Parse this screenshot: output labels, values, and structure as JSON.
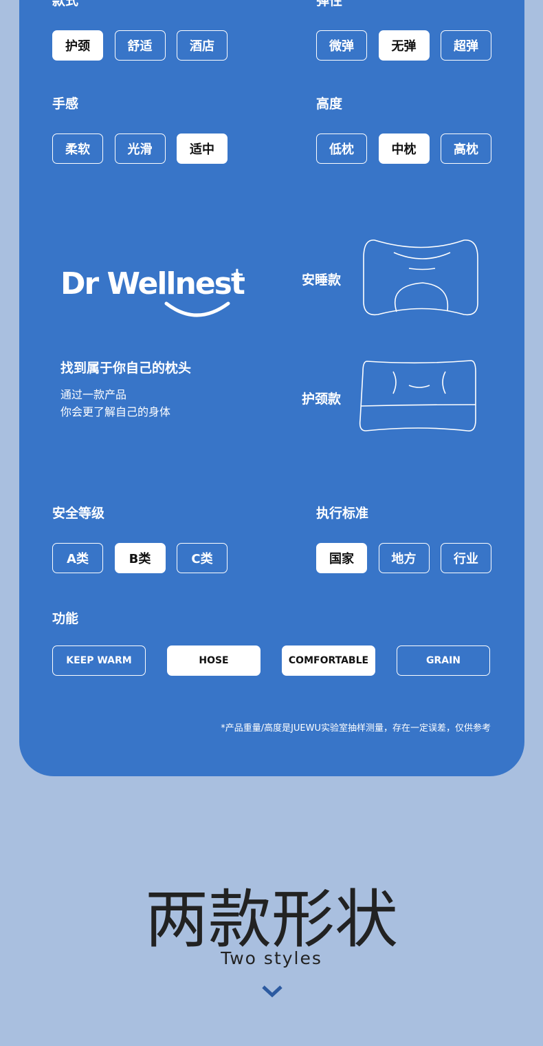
{
  "groups": [
    {
      "label": "款式",
      "options": [
        "护颈",
        "舒适",
        "酒店"
      ],
      "selected": 0
    },
    {
      "label": "弹性",
      "options": [
        "微弹",
        "无弹",
        "超弹"
      ],
      "selected": 1
    },
    {
      "label": "手感",
      "options": [
        "柔软",
        "光滑",
        "适中"
      ],
      "selected": 2
    },
    {
      "label": "高度",
      "options": [
        "低枕",
        "中枕",
        "高枕"
      ],
      "selected": 1
    },
    {
      "label": "安全等级",
      "options": [
        "A类",
        "B类",
        "C类"
      ],
      "selected": 1
    },
    {
      "label": "执行标准",
      "options": [
        "国家",
        "地方",
        "行业"
      ],
      "selected": 0
    }
  ],
  "function": {
    "label": "功能",
    "options": [
      "KEEP WARM",
      "HOSE",
      "COMFORTABLE",
      "GRAIN"
    ],
    "selected": [
      1,
      2
    ]
  },
  "brand": {
    "logo": "Dr Wellnest+",
    "tagline": "找到属于你自己的枕头",
    "desc1": "通过一款产品",
    "desc2": "你会更了解自己的身体"
  },
  "styles": [
    {
      "name": "安睡款"
    },
    {
      "name": "护颈款"
    }
  ],
  "footnote": "*产品重量/高度是JUEWU实验室抽样测量，存在一定误差，仅供参考",
  "section": {
    "title": "两款形状",
    "subtitle": "Two styles",
    "icon": "chevron-down-icon"
  },
  "colors": {
    "panel": "#3875c8",
    "background": "#a9bfdf"
  }
}
